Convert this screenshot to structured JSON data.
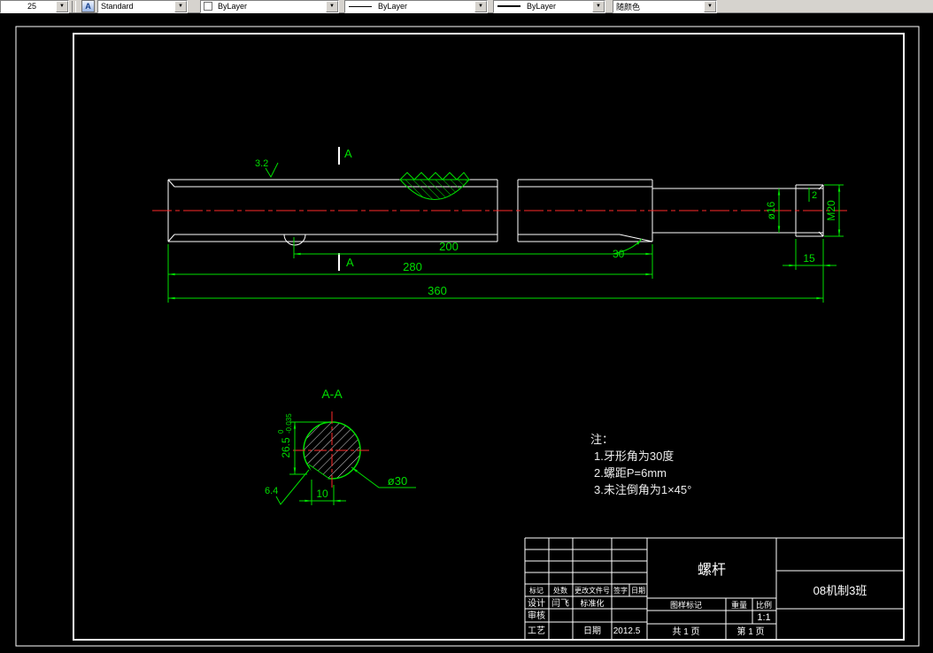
{
  "toolbar": {
    "layer_value": "25",
    "text_style_value": "Standard",
    "color_value": "ByLayer",
    "linetype_value": "ByLayer",
    "lineweight_value": "ByLayer",
    "plot_style_value": "随颜色",
    "arrow_glyph": "▼",
    "style_icon_glyph": "A"
  },
  "colors": {
    "dimension_green": "#00df00",
    "outline_white": "#ffffff",
    "centerline_red": "#ff2a2a",
    "toolbar_gray": "#d6d3ce"
  },
  "main_view": {
    "roughness": "3.2",
    "section_mark_top": "A",
    "section_mark_bottom": "A",
    "dim_length_200": "200",
    "dim_length_280": "280",
    "dim_length_360": "360",
    "dim_length_15": "15",
    "dim_dia_16": "ø16",
    "dim_thread": "M20",
    "dim_chamfer": "2",
    "dim_angle": "30"
  },
  "section_view": {
    "title": "A-A",
    "dim_dia_30": "ø30",
    "dim_width_10": "10",
    "dim_height": "26.5",
    "tol_upper": "0",
    "tol_lower": "-0.035",
    "roughness": "6.4"
  },
  "notes": {
    "header": "注：",
    "items": [
      "1.牙形角为30度",
      "2.螺距P=6mm",
      "3.未注倒角为1×45°"
    ]
  },
  "title_block": {
    "part_name": "螺杆",
    "class_name": "08机制3班",
    "header_row": [
      "标记",
      "处数",
      "更改文件号",
      "签字",
      "日期"
    ],
    "design_label": "设计",
    "design_name": "闫飞",
    "standardize_label": "标准化",
    "check_label": "审核",
    "process_label": "工艺",
    "date_label": "日期",
    "date_value": "2012.5",
    "mark_label": "图样标记",
    "weight_label": "重量",
    "scale_label": "比例",
    "scale_value": "1:1",
    "total_pages": "共 1 页",
    "page_number": "第 1 页"
  }
}
